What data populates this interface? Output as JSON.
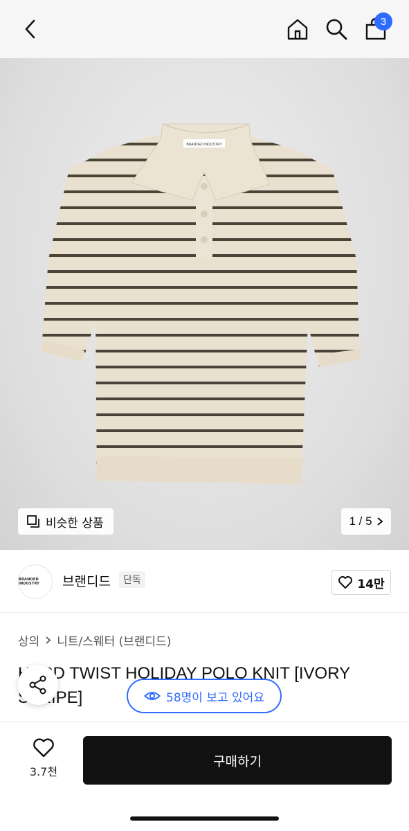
{
  "header": {
    "cart_count": "3",
    "icons": [
      "chevron-left-icon",
      "home-icon",
      "search-icon",
      "shopping-bag-icon"
    ]
  },
  "hero": {
    "shirt_label": "BRANDED INDUSTRY",
    "similar_label": "비슷한 상품",
    "pager": "1 / 5"
  },
  "brand": {
    "logo_text": "BRANDED INDUSTRY",
    "name": "브랜디드",
    "tag": "단독",
    "likes": "14만"
  },
  "breadcrumb": {
    "category": "상의",
    "subcategory": "니트/스웨터 (브랜디드)"
  },
  "product": {
    "title": "HARD TWIST HOLIDAY POLO KNIT [IVORY STRIPE]",
    "viewers": "58명이 보고 있어요"
  },
  "bottom": {
    "wish_count": "3.7천",
    "buy_label": "구매하기"
  },
  "colors": {
    "accent": "#2f6bff",
    "buy_button": "#111111",
    "knit_base": "#e9e0cf",
    "stripe": "#4a4338"
  }
}
